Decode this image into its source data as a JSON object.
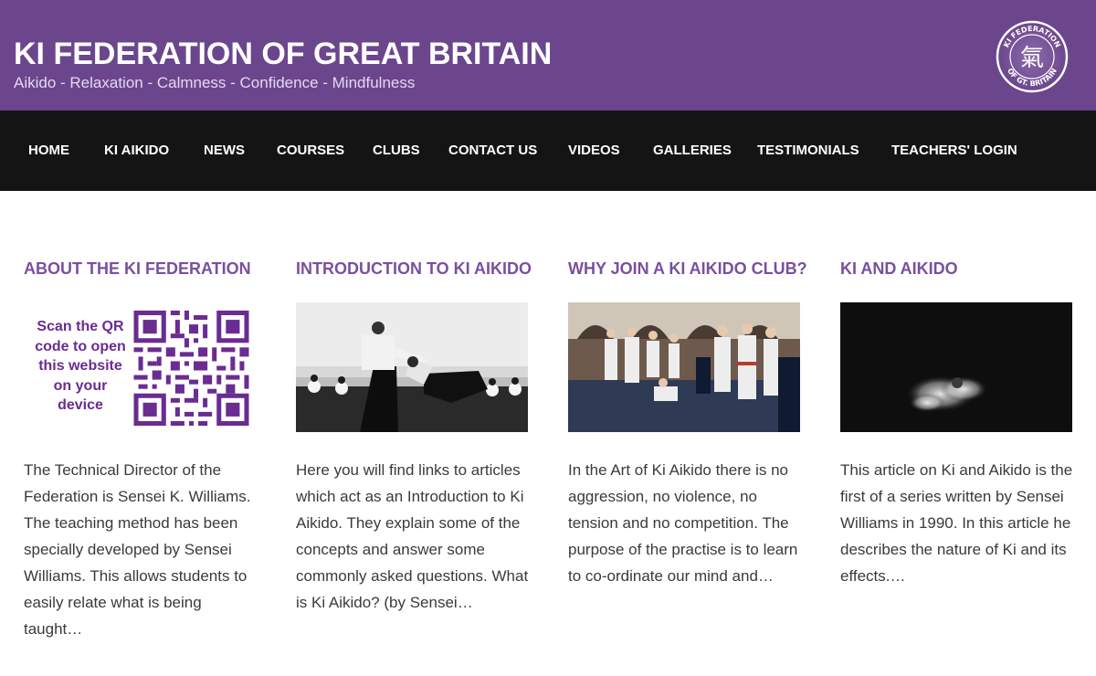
{
  "header": {
    "title": "KI FEDERATION OF GREAT BRITAIN",
    "tagline": "Aikido - Relaxation - Calmness - Confidence - Mindfulness",
    "logo_text_top": "KI FEDERATION",
    "logo_text_bottom": "OF GT. BRITAIN",
    "logo_glyph": "氣"
  },
  "nav": {
    "items": [
      {
        "label": "HOME"
      },
      {
        "label": "KI AIKIDO"
      },
      {
        "label": "NEWS"
      },
      {
        "label": "COURSES"
      },
      {
        "label": "CLUBS"
      },
      {
        "label": "CONTACT US"
      },
      {
        "label": "VIDEOS"
      },
      {
        "label": "GALLERIES"
      },
      {
        "label": "TESTIMONIALS"
      },
      {
        "label": "TEACHERS' LOGIN"
      }
    ]
  },
  "cards": [
    {
      "title": "ABOUT THE KI FEDERATION",
      "image_text": "Scan the QR code to open this website on your device",
      "excerpt": "The Technical Director of the Federation is Sensei K. Williams. The teaching method has been specially developed by Sensei Williams. This allows students to easily relate what is being taught…"
    },
    {
      "title": "INTRODUCTION TO KI AIKIDO",
      "excerpt": "Here you will find links to articles which act as an Introduction to Ki Aikido. They explain some of the concepts and answer some commonly asked questions. What is Ki Aikido? (by Sensei…"
    },
    {
      "title": "WHY JOIN A KI AIKIDO CLUB?",
      "excerpt": "In the Art of Ki Aikido there is no aggression, no violence, no tension and no competition. The purpose of the practise is to learn to co-ordinate our mind and…"
    },
    {
      "title": "KI AND AIKIDO",
      "excerpt": "This article on Ki and Aikido is the first of a series written by Sensei Williams in 1990. In this article he describes the nature of Ki and its effects.…"
    }
  ],
  "colors": {
    "header_bg": "#6b468d",
    "nav_bg": "#141414",
    "accent": "#7a4fa0",
    "qr_purple": "#6a2c91"
  }
}
